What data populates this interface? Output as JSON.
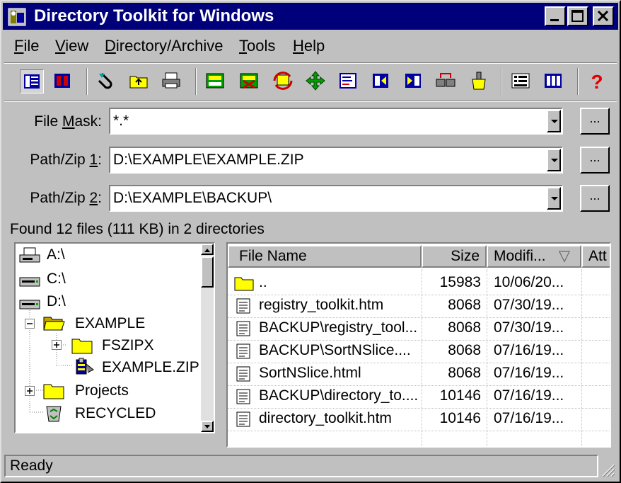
{
  "window": {
    "title": "Directory Toolkit for Windows",
    "controls": [
      "minimize",
      "maximize",
      "close"
    ]
  },
  "menu": [
    {
      "label": "File",
      "u": "F",
      "rest": "ile"
    },
    {
      "label": "View",
      "u": "V",
      "rest": "iew"
    },
    {
      "label": "Directory/Archive",
      "u": "D",
      "rest": "irectory/Archive"
    },
    {
      "label": "Tools",
      "u": "T",
      "rest": "ools"
    },
    {
      "label": "Help",
      "u": "H",
      "rest": "elp"
    }
  ],
  "toolbar": {
    "icons": [
      "tree-view-icon",
      "list-view-icon",
      "attach-icon",
      "up-folder-icon",
      "print-icon",
      "archive-extract-icon",
      "archive-delete-icon",
      "sync-icon",
      "move-icon",
      "compare-left-icon",
      "compare-split-icon",
      "compare-right-icon",
      "network-icon",
      "clean-icon",
      "options-icon",
      "columns-icon",
      "help-icon"
    ]
  },
  "filters": {
    "file_mask_label_pre": "File ",
    "file_mask_label_u": "M",
    "file_mask_label_post": "ask:",
    "file_mask_value": "*.*",
    "path1_label_pre": "Path/Zip ",
    "path1_label_u": "1",
    "path1_label_post": ":",
    "path1_value": "D:\\EXAMPLE\\EXAMPLE.ZIP",
    "path2_label_pre": "Path/Zip ",
    "path2_label_u": "2",
    "path2_label_post": ":",
    "path2_value": "D:\\EXAMPLE\\BACKUP\\",
    "browse_label": "..."
  },
  "summary": "Found 12 files (111 KB) in 2 directories",
  "tree": {
    "items": [
      {
        "label": "A:\\",
        "icon": "floppy-drive-icon"
      },
      {
        "label": "C:\\",
        "icon": "hard-drive-icon"
      },
      {
        "label": "D:\\",
        "icon": "hard-drive-icon"
      },
      {
        "label": "EXAMPLE",
        "icon": "open-folder-icon"
      },
      {
        "label": "FSZIPX",
        "icon": "folder-icon"
      },
      {
        "label": "EXAMPLE.ZIP",
        "icon": "zip-archive-icon"
      },
      {
        "label": "Projects",
        "icon": "folder-icon"
      },
      {
        "label": "RECYCLED",
        "icon": "recycle-bin-icon"
      }
    ]
  },
  "files": {
    "columns": {
      "name": "File Name",
      "size": "Size",
      "modified": "Modifi...",
      "attr": "Att"
    },
    "sort_indicator": "▽",
    "rows": [
      {
        "name": "..",
        "size": "15983",
        "modified": "10/06/20...",
        "icon": "folder-icon"
      },
      {
        "name": "registry_toolkit.htm",
        "size": "8068",
        "modified": "07/30/19...",
        "icon": "document-icon"
      },
      {
        "name": "BACKUP\\registry_tool....",
        "size": "8068",
        "modified": "07/30/19...",
        "icon": "document-icon"
      },
      {
        "name": "BACKUP\\SortNSlice....",
        "size": "8068",
        "modified": "07/16/19...",
        "icon": "document-icon"
      },
      {
        "name": "SortNSlice.html",
        "size": "8068",
        "modified": "07/16/19...",
        "icon": "document-icon"
      },
      {
        "name": "BACKUP\\directory_to....",
        "size": "10146",
        "modified": "07/16/19...",
        "icon": "document-icon"
      },
      {
        "name": "directory_toolkit.htm",
        "size": "10146",
        "modified": "07/16/19...",
        "icon": "document-icon"
      }
    ]
  },
  "status": "Ready"
}
